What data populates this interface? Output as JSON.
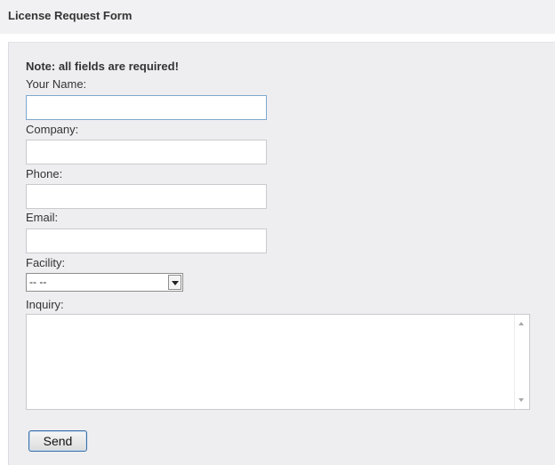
{
  "header": {
    "title": "License Request Form"
  },
  "form": {
    "note": "Note: all fields are required!",
    "fields": {
      "name": {
        "label": "Your Name:",
        "value": ""
      },
      "company": {
        "label": "Company:",
        "value": ""
      },
      "phone": {
        "label": "Phone:",
        "value": ""
      },
      "email": {
        "label": "Email:",
        "value": ""
      },
      "facility": {
        "label": "Facility:",
        "selected": "-- --"
      },
      "inquiry": {
        "label": "Inquiry:",
        "value": ""
      }
    },
    "send_label": "Send"
  },
  "icons": {
    "select_arrow": "chevron-down-icon",
    "scroll_up": "scroll-up-arrow-icon",
    "scroll_down": "scroll-down-arrow-icon"
  },
  "colors": {
    "header_bg": "#f1f1f3",
    "panel_bg": "#eeeef1",
    "text": "#333333",
    "focus_border": "#7fa7cc",
    "button_border": "#3a6ea5"
  }
}
